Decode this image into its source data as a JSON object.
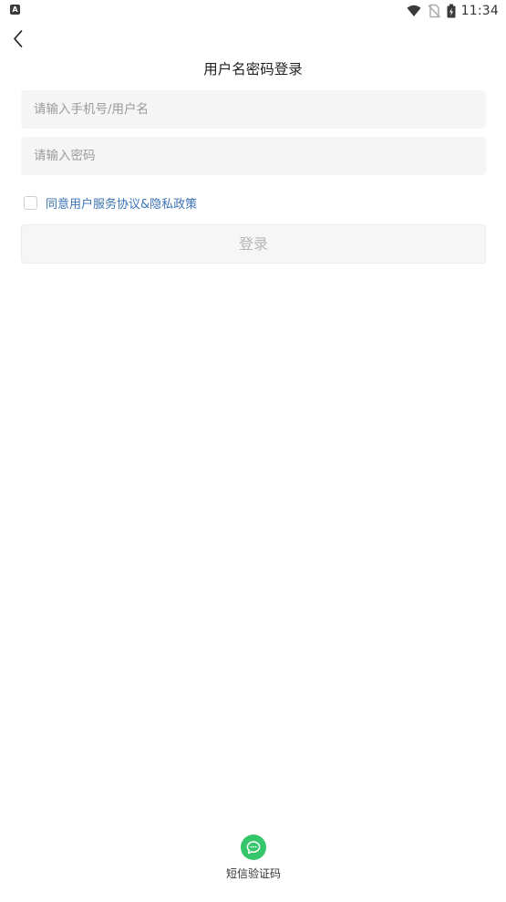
{
  "status_bar": {
    "app_icon_letter": "A",
    "time": "11:34",
    "icons": [
      "wifi-icon",
      "no-sim-icon",
      "battery-icon"
    ]
  },
  "header": {
    "back_icon": "chevron-left-icon",
    "title": "用户名密码登录"
  },
  "form": {
    "username_placeholder": "请输入手机号/用户名",
    "username_value": "",
    "password_placeholder": "请输入密码",
    "password_value": "",
    "agreement_checked": false,
    "agreement_label": "同意用户服务协议&隐私政策",
    "login_label": "登录"
  },
  "footer": {
    "sms_login_icon": "message-icon",
    "sms_login_label": "短信验证码"
  },
  "colors": {
    "field_background": "#f5f5f5",
    "agreement_link": "#3a72b4",
    "login_disabled_text": "#b6b6b6",
    "sms_icon_green": "#35c56a"
  }
}
